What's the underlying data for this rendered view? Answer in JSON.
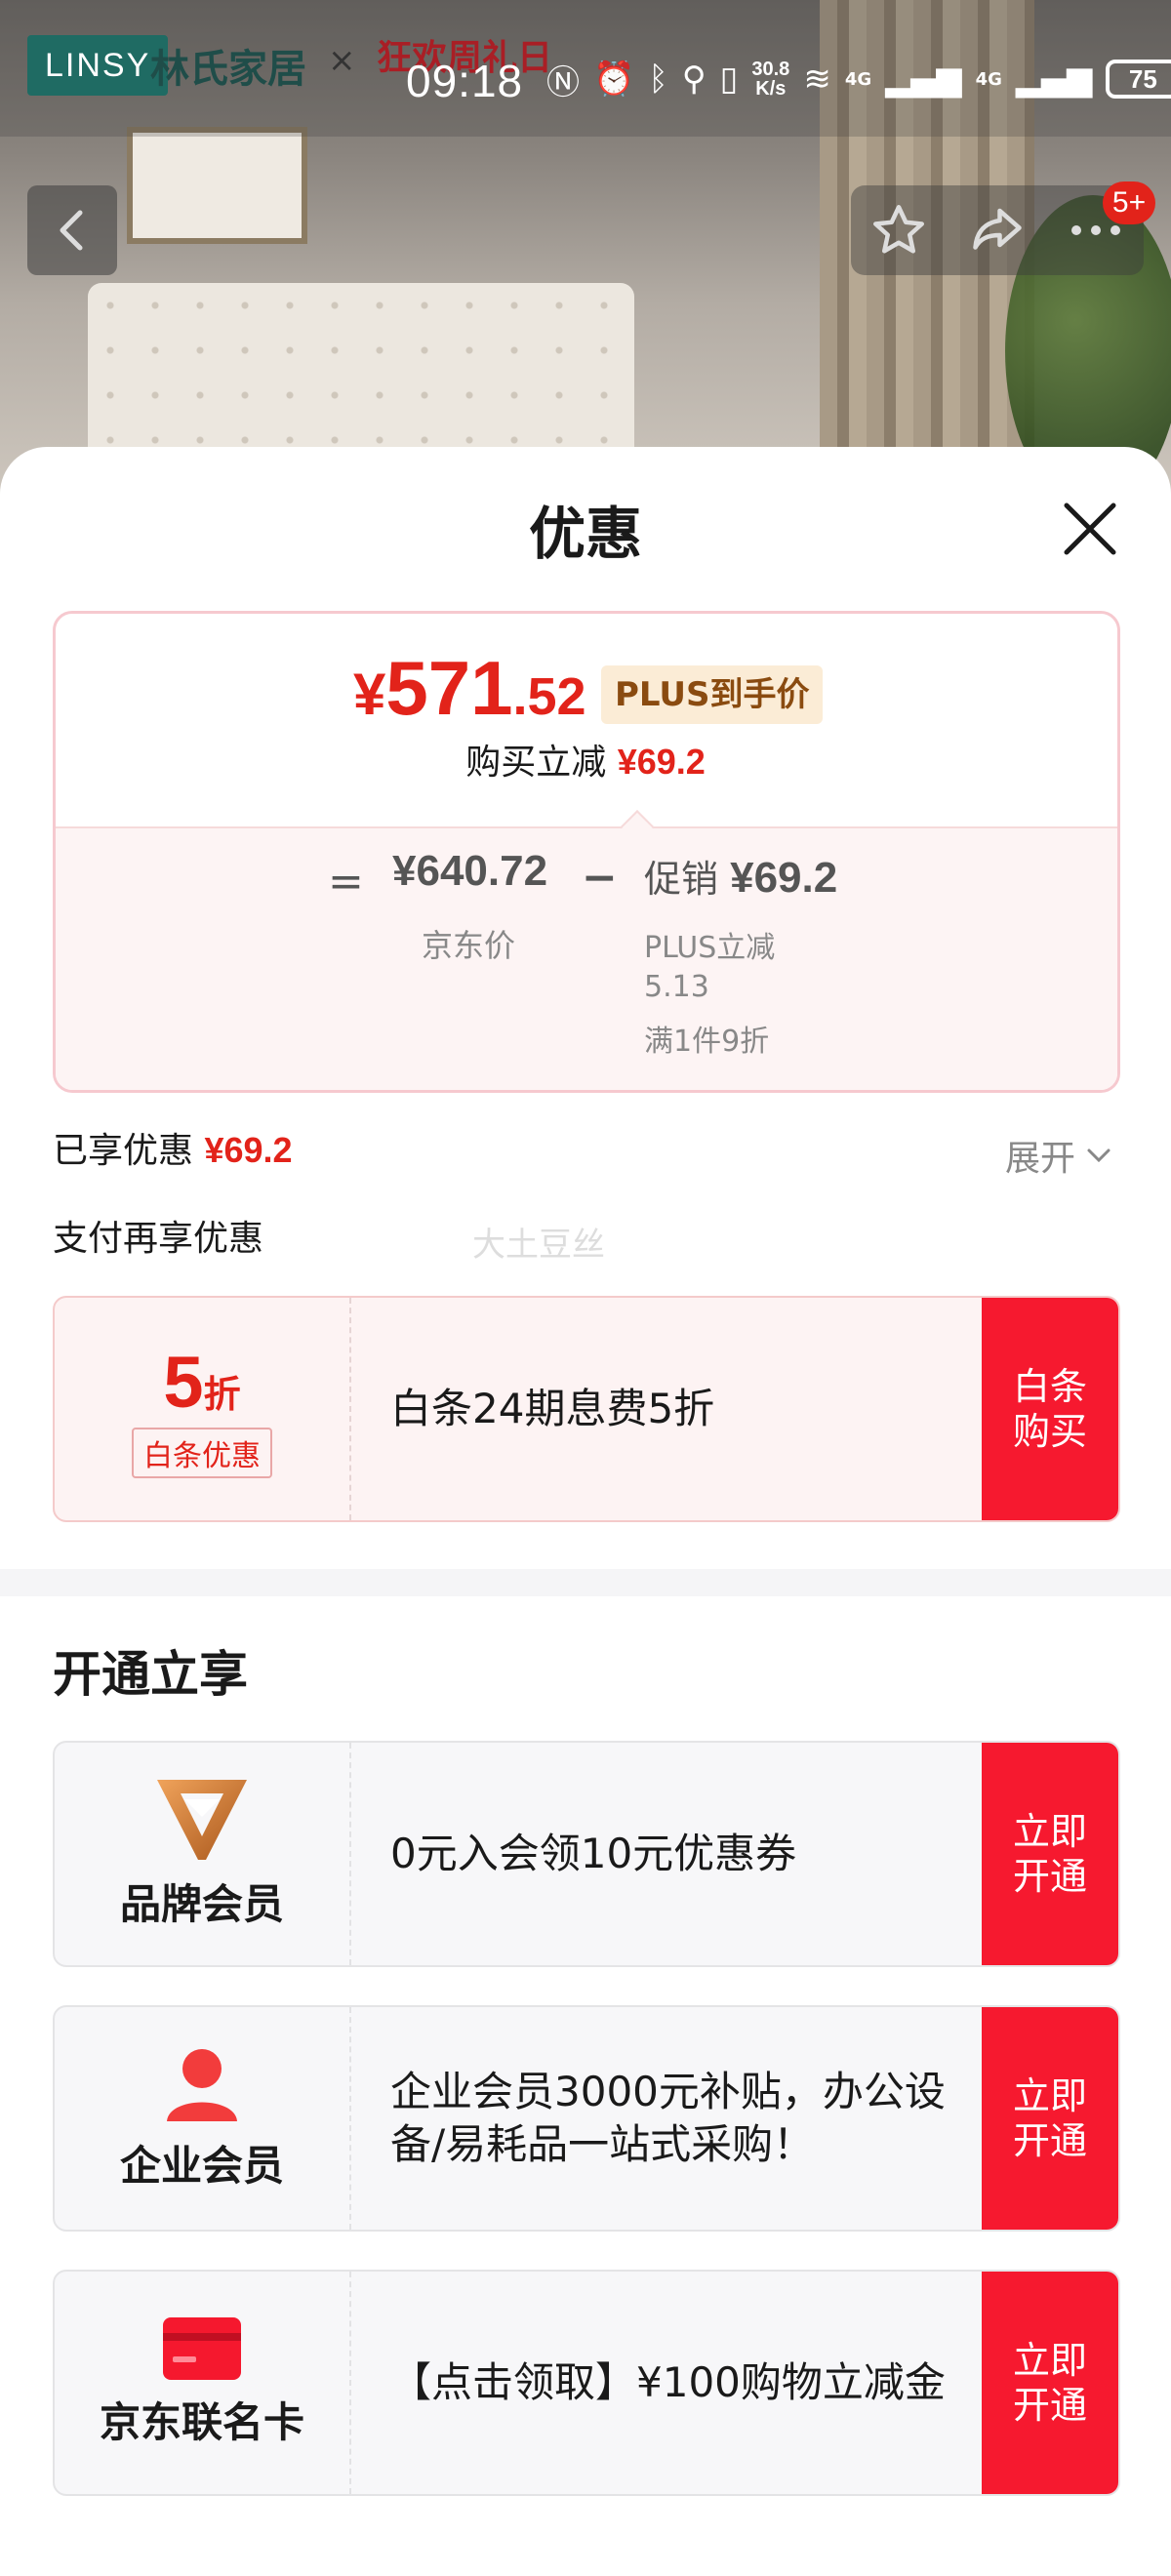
{
  "status_bar": {
    "brand_logo_text": "LINSY",
    "brand_name": "林氏家居",
    "brand_separator": "×",
    "brand_partner": "狂欢周礼日",
    "time": "09:18",
    "net_speed_value": "30.8",
    "net_speed_unit": "K/s",
    "signal_1": "4G",
    "signal_2": "4G",
    "battery": "75"
  },
  "nav": {
    "badge": "5+"
  },
  "sheet": {
    "title": "优惠"
  },
  "price_card": {
    "final_currency": "¥",
    "final_int": "571",
    "final_dec": ".52",
    "plus_tag": "PLUS到手价",
    "reduce_label": "购买立减",
    "reduce_amount": "¥69.2",
    "equals": "=",
    "jd_price": "¥640.72",
    "jd_label": "京东价",
    "minus": "−",
    "promo_label": "促销",
    "promo_amount": "¥69.2",
    "promo_sub_1": "PLUS立减",
    "promo_sub_2": "5.13",
    "promo_sub_3": "满1件9折"
  },
  "discount_summary": {
    "enjoyed_label": "已享优惠",
    "enjoyed_amount": "¥69.2",
    "expand_label": "展开",
    "pay_more_label": "支付再享优惠",
    "watermark": "大土豆丝"
  },
  "baitiao_coupon": {
    "discount_number": "5",
    "discount_unit": "折",
    "tag": "白条优惠",
    "description": "白条24期息费5折",
    "action": "白条\n购买"
  },
  "membership_section": {
    "title": "开通立享",
    "cards": [
      {
        "name": "品牌会员",
        "icon": "brand-v-icon",
        "description": "0元入会领10元优惠券",
        "action": "立即\n开通"
      },
      {
        "name": "企业会员",
        "icon": "person-icon",
        "description": "企业会员3000元补贴，办公设备/易耗品一站式采购！",
        "action": "立即\n开通"
      },
      {
        "name": "京东联名卡",
        "icon": "card-icon",
        "description": "【点击领取】¥100购物立减金",
        "action": "立即\n开通"
      }
    ]
  },
  "colors": {
    "accent_red": "#e2231a",
    "action_red": "#f6192f",
    "plus_gold": "#8a4b10"
  }
}
